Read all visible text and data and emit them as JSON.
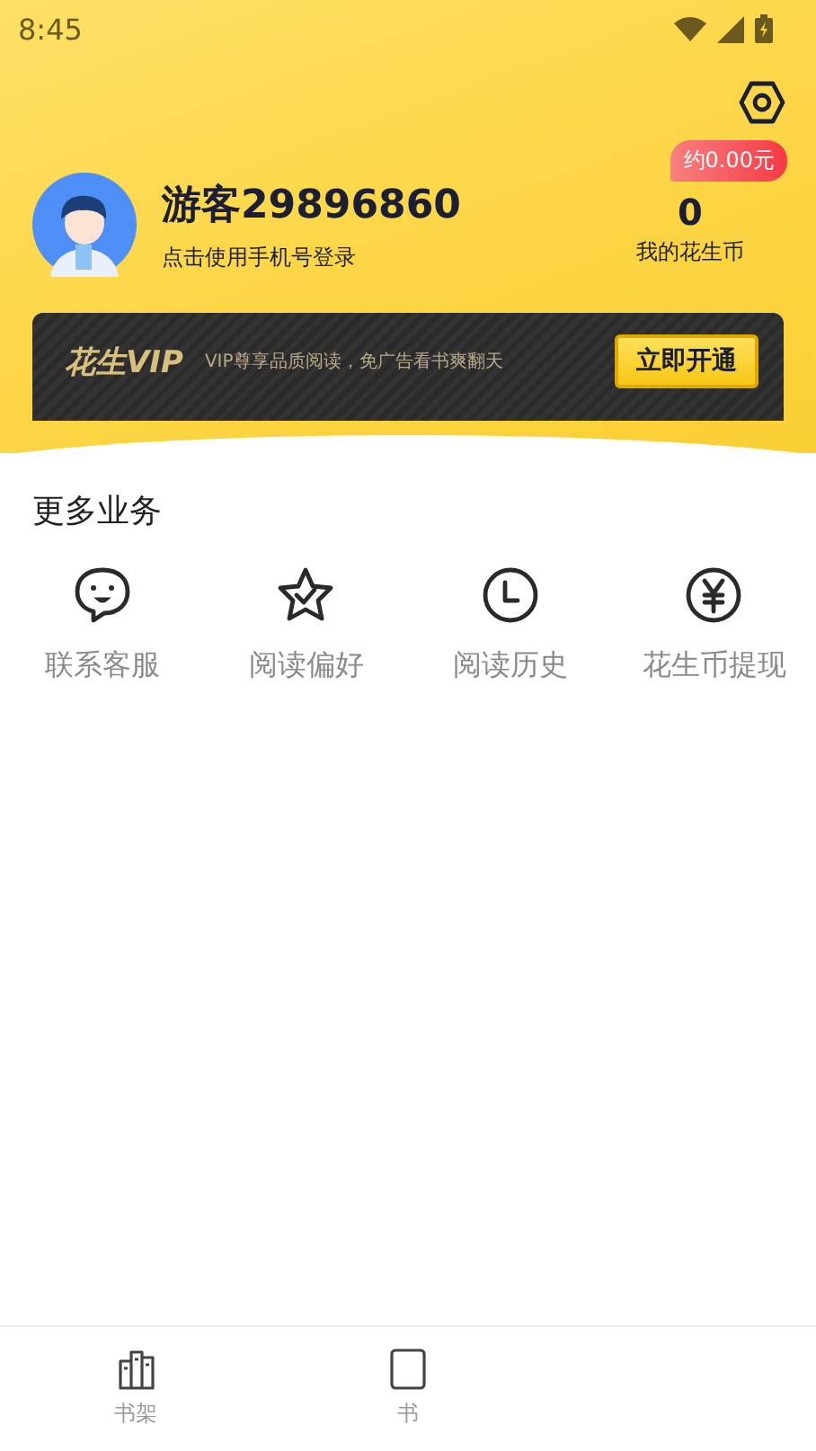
{
  "status_bar": {
    "time": "8:45"
  },
  "profile": {
    "name": "游客29896860",
    "subtitle": "点击使用手机号登录"
  },
  "coins": {
    "badge": "约0.00元",
    "count": "0",
    "label": "我的花生币"
  },
  "vip": {
    "logo": "花生VIP",
    "slogan": "VIP尊享品质阅读，免广告看书爽翻天",
    "button": "立即开通"
  },
  "services": {
    "title": "更多业务",
    "items": [
      {
        "kind": "chat",
        "label": "联系客服"
      },
      {
        "kind": "star",
        "label": "阅读偏好"
      },
      {
        "kind": "clock",
        "label": "阅读历史"
      },
      {
        "kind": "yen",
        "label": "花生币提现"
      }
    ]
  },
  "bottom_nav": [
    {
      "kind": "shelf",
      "label": "书架",
      "selected": false
    },
    {
      "kind": "book",
      "label": "书",
      "selected": false
    }
  ]
}
